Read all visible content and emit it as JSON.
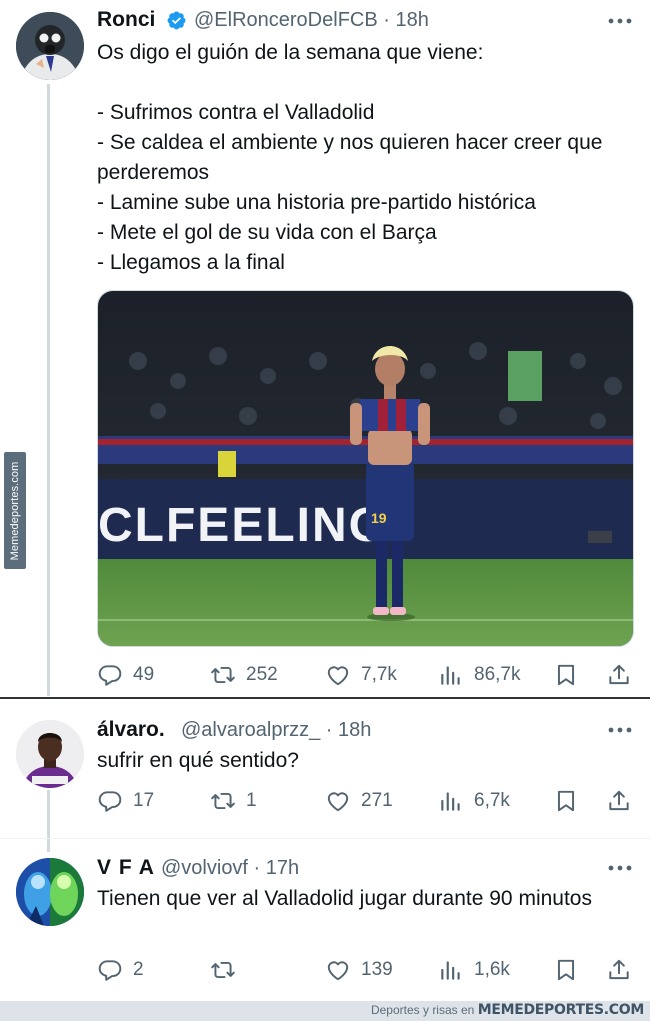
{
  "watermark": {
    "side": "Memedeportes.com",
    "footer_small": "Deportes y risas en",
    "footer_brand": "MEMEDEPORTES.COM"
  },
  "tweets": [
    {
      "name": "Ronci",
      "verified": true,
      "handle": "@ElRonceroDelFCB · 18h",
      "text": "Os digo el guión de la semana que viene:\n\n- Sufrimos contra el Valladolid\n- Se caldea el ambiente y nos quieren hacer creer que perderemos\n- Lamine sube una historia pre-partido histórica\n- Mete el gol de su vida con el Barça\n- Llegamos a la final",
      "media": {
        "board_text": "CLFEELING",
        "shirt_number": "19"
      },
      "stats": {
        "replies": "49",
        "retweets": "252",
        "likes": "7,7k",
        "views": "86,7k"
      }
    },
    {
      "name": "álvaro.",
      "verified": false,
      "handle": "@alvaroalprzz_ · 18h",
      "text": "sufrir en qué sentido?",
      "stats": {
        "replies": "17",
        "retweets": "1",
        "likes": "271",
        "views": "6,7k"
      }
    },
    {
      "name": "V F A",
      "verified": false,
      "handle": "@volviovf · 17h",
      "text": "Tienen que ver al Valladolid jugar durante 90 minutos",
      "stats": {
        "replies": "2",
        "retweets": "",
        "likes": "139",
        "views": "1,6k"
      }
    }
  ],
  "colors": {
    "text": "#0f1419",
    "secondary": "#536471",
    "verified": "#1d9bf0",
    "line": "#cfd9de"
  }
}
